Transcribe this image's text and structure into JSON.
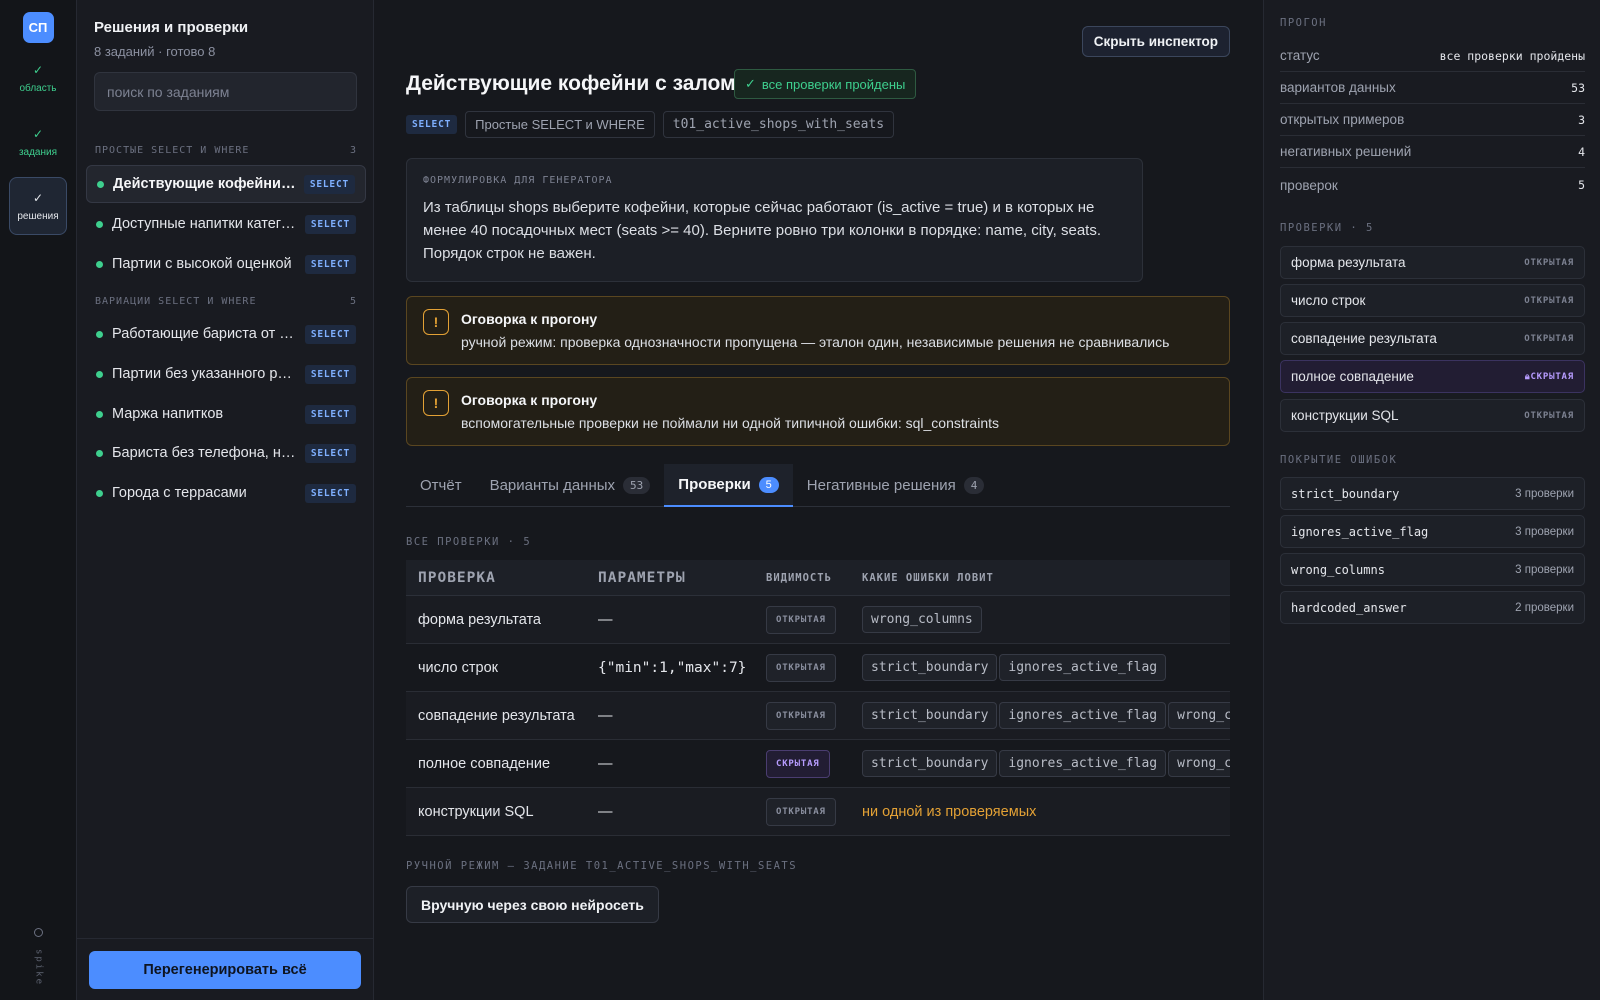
{
  "rail": {
    "logo": "СП",
    "items": [
      {
        "label": "область"
      },
      {
        "label": "задания"
      },
      {
        "label": "решения"
      }
    ],
    "footer": "spike"
  },
  "sidebar": {
    "title": "Решения и проверки",
    "subtitle": "8 заданий · готово 8",
    "search_placeholder": "поиск по заданиям",
    "groups": [
      {
        "title": "ПРОСТЫЕ SELECT И WHERE",
        "count": "3",
        "items": [
          {
            "label": "Действующие кофейни с залом",
            "badge": "SELECT"
          },
          {
            "label": "Доступные напитки категории",
            "badge": "SELECT"
          },
          {
            "label": "Партии с высокой оценкой",
            "badge": "SELECT"
          }
        ]
      },
      {
        "title": "ВАРИАЦИИ SELECT И WHERE",
        "count": "5",
        "items": [
          {
            "label": "Работающие бариста от стажа",
            "badge": "SELECT"
          },
          {
            "label": "Партии без указанного региона",
            "badge": "SELECT"
          },
          {
            "label": "Маржа напитков",
            "badge": "SELECT"
          },
          {
            "label": "Бариста без телефона, но с почтой",
            "badge": "SELECT"
          },
          {
            "label": "Города с террасами",
            "badge": "SELECT"
          }
        ]
      }
    ],
    "regenerate_label": "Перегенерировать всё"
  },
  "main": {
    "hide_inspector": "Скрыть инспектор",
    "title": "Действующие кофейни с залом",
    "status_badge": "все проверки пройдены",
    "tags": {
      "select": "SELECT",
      "group": "Простые SELECT и WHERE",
      "id": "t01_active_shops_with_seats"
    },
    "prompt_head": "ФОРМУЛИРОВКА ДЛЯ ГЕНЕРАТОРА",
    "prompt_text": "Из таблицы shops выберите кофейни, которые сейчас работают (is_active = true) и в которых не менее 40 посадочных мест (seats >= 40). Верните ровно три колонки в порядке: name, city, seats. Порядок строк не важен.",
    "warnings": [
      {
        "icon": "!",
        "title": "Оговорка к прогону",
        "text": "ручной режим: проверка однозначности пропущена — эталон один, независимые решения не сравнивались"
      },
      {
        "icon": "!",
        "title": "Оговорка к прогону",
        "text": "вспомогательные проверки не поймали ни одной типичной ошибки: sql_constraints"
      }
    ],
    "tabs": [
      {
        "label": "Отчёт",
        "count": ""
      },
      {
        "label": "Варианты данных",
        "count": "53"
      },
      {
        "label": "Проверки",
        "count": "5"
      },
      {
        "label": "Негативные решения",
        "count": "4"
      }
    ],
    "checks_head": "ВСЕ ПРОВЕРКИ · 5",
    "table": {
      "headers": [
        "ПРОВЕРКА",
        "ПАРАМЕТРЫ",
        "ВИДИМОСТЬ",
        "КАКИЕ ОШИБКИ ЛОВИТ"
      ],
      "rows": [
        {
          "name": "форма результата",
          "params": "—",
          "visibility": "ОТКРЫТАЯ",
          "errors": [
            "wrong_columns"
          ]
        },
        {
          "name": "число строк",
          "params": "{\"min\":1,\"max\":7}",
          "visibility": "ОТКРЫТАЯ",
          "errors": [
            "strict_boundary",
            "ignores_active_flag"
          ]
        },
        {
          "name": "совпадение результата",
          "params": "—",
          "visibility": "ОТКРЫТАЯ",
          "errors": [
            "strict_boundary",
            "ignores_active_flag",
            "wrong_columns"
          ]
        },
        {
          "name": "полное совпадение",
          "params": "—",
          "visibility": "СКРЫТАЯ",
          "errors": [
            "strict_boundary",
            "ignores_active_flag",
            "wrong_columns"
          ]
        },
        {
          "name": "конструкции SQL",
          "params": "—",
          "visibility": "ОТКРЫТАЯ",
          "errors_text": "ни одной из проверяемых"
        }
      ]
    },
    "manual_head": "РУЧНОЙ РЕЖИМ — ЗАДАНИЕ T01_ACTIVE_SHOPS_WITH_SEATS",
    "manual_button": "Вручную через свою нейросеть"
  },
  "inspector": {
    "run_head": "ПРОГОН",
    "run": [
      {
        "k": "статус",
        "v": "все проверки пройдены"
      },
      {
        "k": "вариантов данных",
        "v": "53"
      },
      {
        "k": "открытых примеров",
        "v": "3"
      },
      {
        "k": "негативных решений",
        "v": "4"
      },
      {
        "k": "проверок",
        "v": "5"
      }
    ],
    "checks_head": "ПРОВЕРКИ · 5",
    "checks": [
      {
        "name": "форма результата",
        "vis": "ОТКРЫТАЯ"
      },
      {
        "name": "число строк",
        "vis": "ОТКРЫТАЯ"
      },
      {
        "name": "совпадение результата",
        "vis": "ОТКРЫТАЯ"
      },
      {
        "name": "полное совпадение",
        "vis": "СКРЫТАЯ"
      },
      {
        "name": "конструкции SQL",
        "vis": "ОТКРЫТАЯ"
      }
    ],
    "coverage_head": "ПОКРЫТИЕ ОШИБОК",
    "coverage": [
      {
        "name": "strict_boundary",
        "count": "3 проверки"
      },
      {
        "name": "ignores_active_flag",
        "count": "3 проверки"
      },
      {
        "name": "wrong_columns",
        "count": "3 проверки"
      },
      {
        "name": "hardcoded_answer",
        "count": "2 проверки"
      }
    ]
  }
}
